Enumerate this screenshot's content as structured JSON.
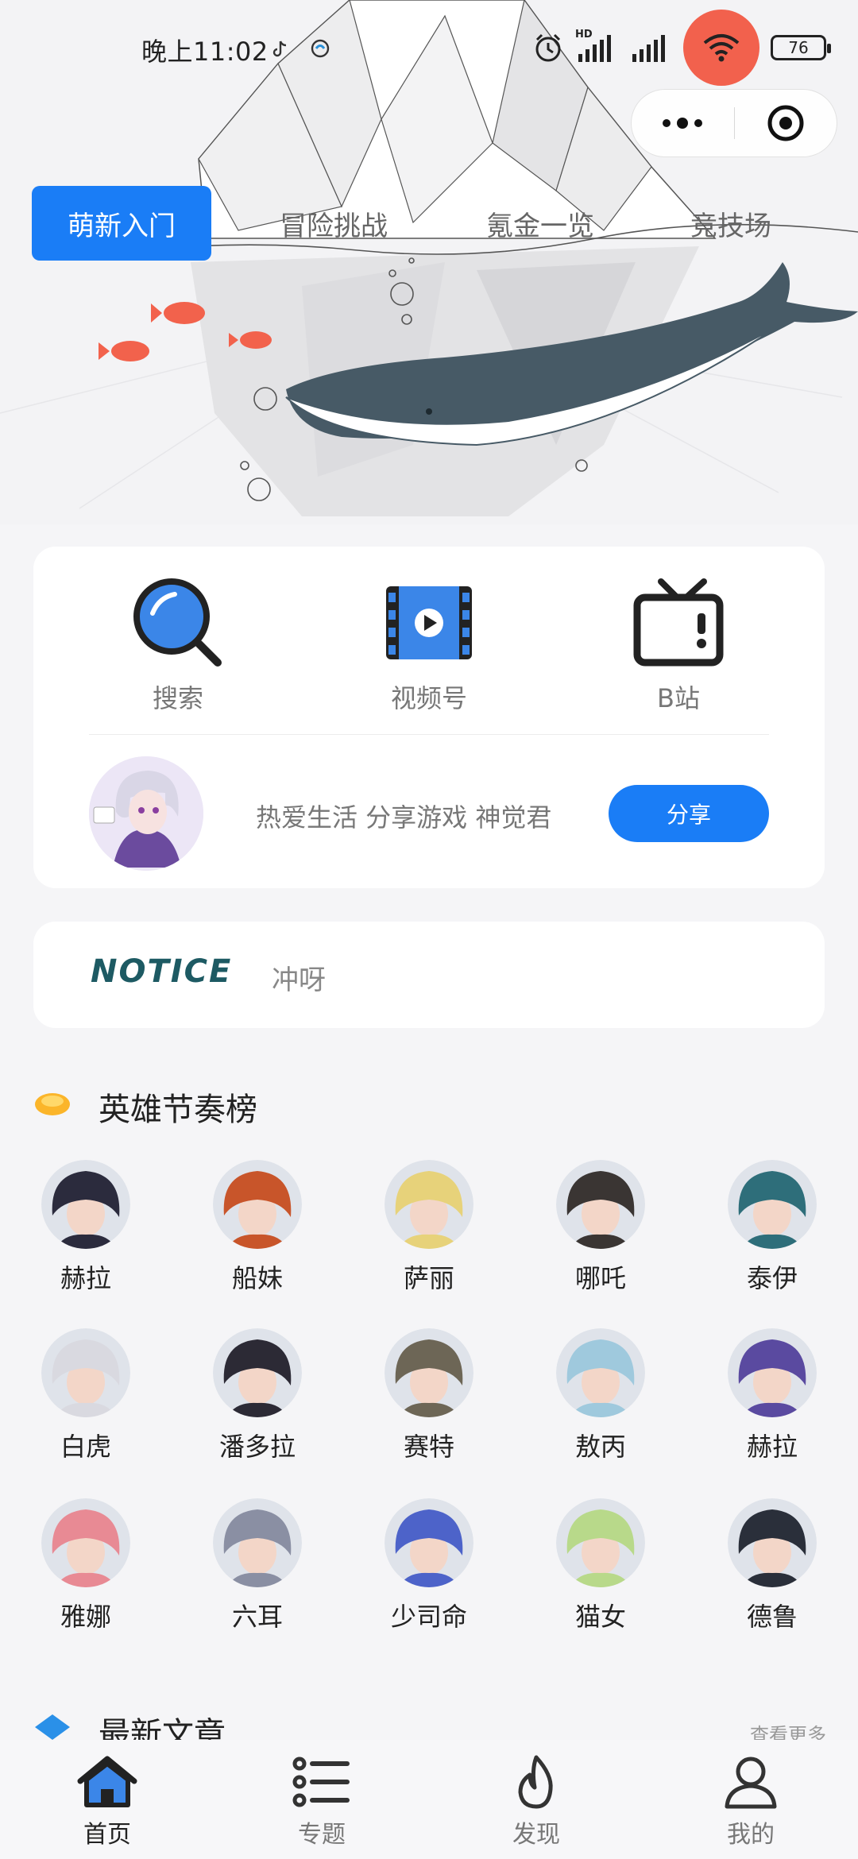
{
  "status_bar": {
    "time": "晚上11:02",
    "hd_label": "HD",
    "battery": "76"
  },
  "tabs": [
    {
      "label": "萌新入门",
      "active": true
    },
    {
      "label": "冒险挑战",
      "active": false
    },
    {
      "label": "氪金一览",
      "active": false
    },
    {
      "label": "竞技场",
      "active": false
    }
  ],
  "quick_links": [
    {
      "label": "搜索",
      "icon": "search-icon"
    },
    {
      "label": "视频号",
      "icon": "video-channel-icon"
    },
    {
      "label": "B站",
      "icon": "tv-icon"
    }
  ],
  "profile": {
    "tagline": "热爱生活 分享游戏 神觉君",
    "share_label": "分享"
  },
  "notice": {
    "logo_text": "NOTICE",
    "text": "冲呀"
  },
  "heroes_section": {
    "title": "英雄节奏榜"
  },
  "heroes": [
    {
      "name": "赫拉",
      "color": "#2b2b3d"
    },
    {
      "name": "船妹",
      "color": "#c8552a"
    },
    {
      "name": "萨丽",
      "color": "#e7d27a"
    },
    {
      "name": "哪吒",
      "color": "#3a3533"
    },
    {
      "name": "泰伊",
      "color": "#2e6e7a"
    },
    {
      "name": "白虎",
      "color": "#d9d9e0"
    },
    {
      "name": "潘多拉",
      "color": "#2c2a35"
    },
    {
      "name": "赛特",
      "color": "#6d6656"
    },
    {
      "name": "敖丙",
      "color": "#9fc9dd"
    },
    {
      "name": "赫拉",
      "color": "#5a4aa0"
    },
    {
      "name": "雅娜",
      "color": "#e88a94"
    },
    {
      "name": "六耳",
      "color": "#8a8fa3"
    },
    {
      "name": "少司命",
      "color": "#4d63c9"
    },
    {
      "name": "猫女",
      "color": "#b8d98a"
    },
    {
      "name": "德鲁",
      "color": "#2a2f3a"
    }
  ],
  "articles_section": {
    "title": "最新文章",
    "more_label": "查看更多"
  },
  "bottom_nav": [
    {
      "label": "首页",
      "icon": "home-icon",
      "active": true
    },
    {
      "label": "专题",
      "icon": "list-icon",
      "active": false
    },
    {
      "label": "发现",
      "icon": "flame-icon",
      "active": false
    },
    {
      "label": "我的",
      "icon": "user-icon",
      "active": false
    }
  ],
  "colors": {
    "accent": "#1a7df6",
    "whale": "#475a66",
    "fish": "#f2624c"
  }
}
